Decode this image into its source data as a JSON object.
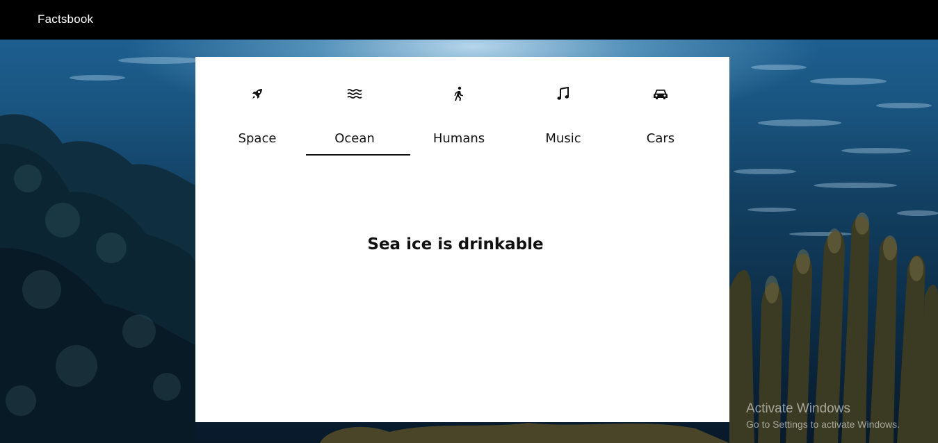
{
  "app": {
    "brand": "Factsbook"
  },
  "tabs": [
    {
      "label": "Space",
      "icon": "rocket-icon",
      "active": false
    },
    {
      "label": "Ocean",
      "icon": "waves-icon",
      "active": true
    },
    {
      "label": "Humans",
      "icon": "walking-person-icon",
      "active": false
    },
    {
      "label": "Music",
      "icon": "music-note-icon",
      "active": false
    },
    {
      "label": "Cars",
      "icon": "car-icon",
      "active": false
    }
  ],
  "fact": {
    "text": "Sea ice is drinkable"
  },
  "watermark": {
    "title": "Activate Windows",
    "subtitle": "Go to Settings to activate Windows."
  },
  "colors": {
    "navbar": "#000000",
    "card": "#ffffff",
    "text": "#111111",
    "ocean": "#19547f"
  }
}
